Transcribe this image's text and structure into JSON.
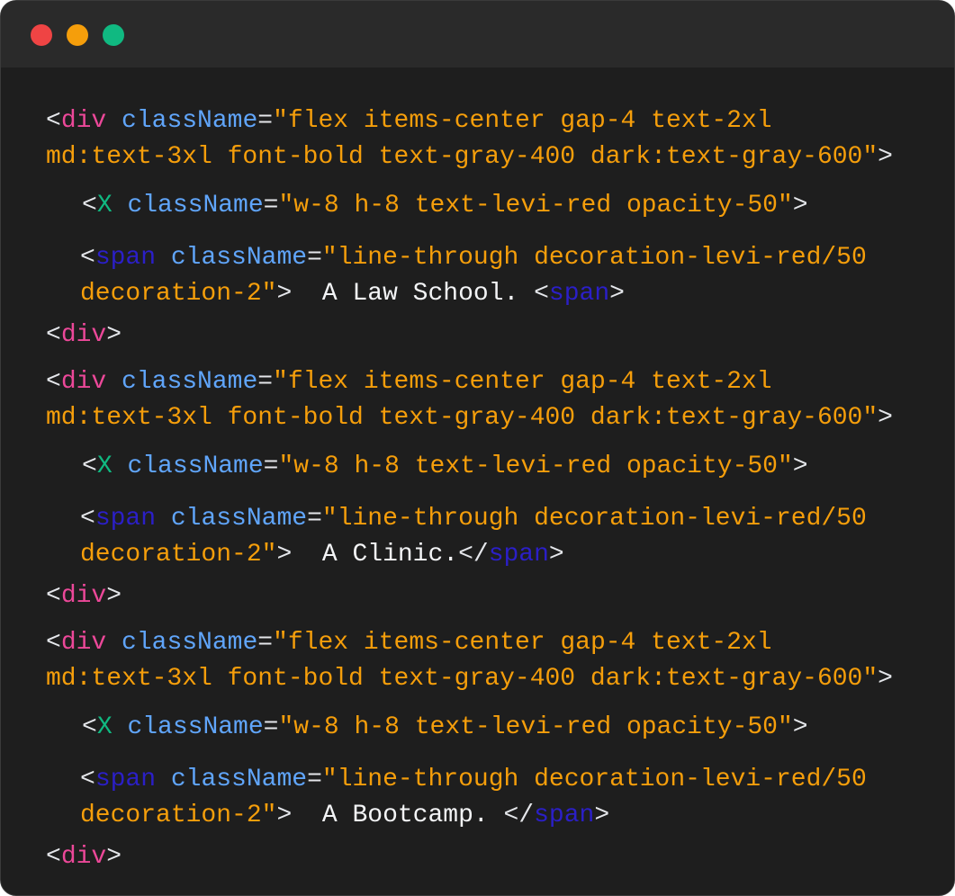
{
  "window": {
    "controls": [
      {
        "name": "close-dot",
        "color": "#ef4444"
      },
      {
        "name": "minimize-dot",
        "color": "#f59e0b"
      },
      {
        "name": "maximize-dot",
        "color": "#10b981"
      }
    ]
  },
  "tokens": {
    "lt": "<",
    "gt": ">",
    "lt_slash": "</",
    "eq": "=",
    "div": "div",
    "x": "X",
    "span": "span",
    "classname": "className"
  },
  "blocks": [
    {
      "div_class_1": "\"flex items-center gap-4 text-2xl",
      "div_class_2": "md:text-3xl font-bold text-gray-400 dark:text-gray-600\"",
      "x_class": "\"w-8 h-8 text-levi-red opacity-50\"",
      "span_class_1": "\"line-through decoration-levi-red/50",
      "span_class_2": "decoration-2\"",
      "text": " A Law School. "
    },
    {
      "div_class_1": "\"flex items-center gap-4 text-2xl",
      "div_class_2": "md:text-3xl font-bold text-gray-400 dark:text-gray-600\"",
      "x_class": "\"w-8 h-8 text-levi-red opacity-50\"",
      "span_class_1": "\"line-through decoration-levi-red/50",
      "span_class_2": "decoration-2\"",
      "text": " A Clinic."
    },
    {
      "div_class_1": "\"flex items-center gap-4 text-2xl",
      "div_class_2": "md:text-3xl font-bold text-gray-400 dark:text-gray-600\"",
      "x_class": "\"w-8 h-8 text-levi-red opacity-50\"",
      "span_class_1": "\"line-through decoration-levi-red/50",
      "span_class_2": "decoration-2\"",
      "text": " A Bootcamp. "
    }
  ],
  "colors": {
    "background": "#1e1e1e",
    "titlebar": "#2a2a2a",
    "tag_div": "#ec4899",
    "tag_x": "#10b981",
    "tag_span": "#2b1fc7",
    "attribute": "#60a5fa",
    "string": "#f59e0b",
    "punctuation": "#e5e7eb"
  }
}
